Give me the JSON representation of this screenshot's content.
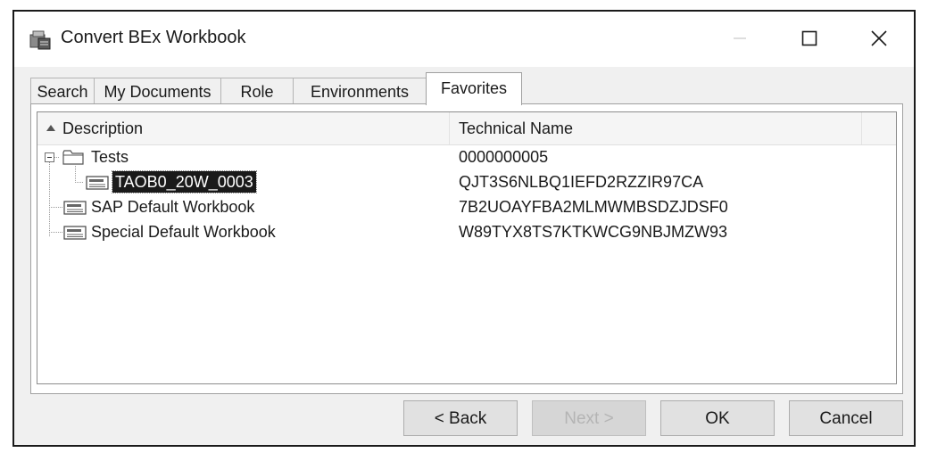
{
  "window": {
    "title": "Convert BEx Workbook"
  },
  "tabs": [
    {
      "label": "Search"
    },
    {
      "label": "My Documents"
    },
    {
      "label": "Role"
    },
    {
      "label": "Environments"
    },
    {
      "label": "Favorites",
      "active": true
    }
  ],
  "table": {
    "columns": [
      "Description",
      "Technical Name"
    ],
    "sort_column": "Description",
    "rows": [
      {
        "description": "Tests",
        "technical_name": "0000000005",
        "icon": "folder-icon",
        "expanded": true
      },
      {
        "description": "TAOB0_20W_0003",
        "technical_name": "QJT3S6NLBQ1IEFD2RZZIR97CA",
        "icon": "workbook-icon",
        "selected": true
      },
      {
        "description": "SAP Default Workbook",
        "technical_name": "7B2UOAYFBA2MLMWMBSDZJDSF0",
        "icon": "workbook-icon"
      },
      {
        "description": "Special Default Workbook",
        "technical_name": "W89TYX8TS7KTKWCG9NBJMZW93",
        "icon": "workbook-icon"
      }
    ]
  },
  "buttons": {
    "back": "< Back",
    "next": "Next >",
    "ok": "OK",
    "cancel": "Cancel"
  },
  "colors": {
    "selection_bg": "#1a1a1a",
    "button_bg": "#e1e1e1",
    "dialog_bg": "#f0f0f0"
  }
}
